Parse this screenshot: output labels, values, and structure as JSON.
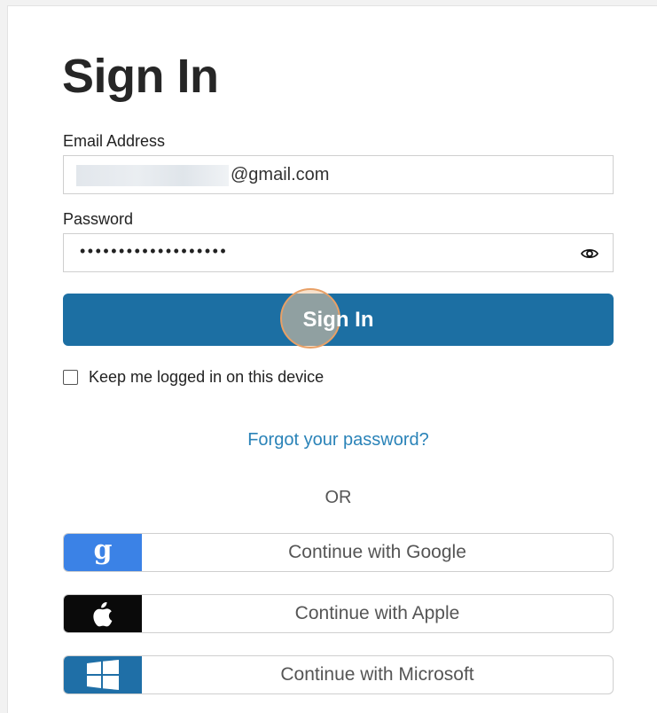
{
  "page": {
    "title": "Sign In"
  },
  "form": {
    "email_label": "Email Address",
    "email_value_visible": "@gmail.com",
    "password_label": "Password",
    "password_value_masked": "•••••••••••••••••••",
    "signin_label": "Sign In",
    "keep_logged_in_label": "Keep me logged in on this device",
    "keep_logged_in_checked": false,
    "forgot_link": "Forgot your password?",
    "or_divider": "OR"
  },
  "sso": [
    {
      "label": "Continue with Google",
      "icon": "google-g-icon",
      "color": "#3b82e6"
    },
    {
      "label": "Continue with Apple",
      "icon": "apple-icon",
      "color": "#0a0a0a"
    },
    {
      "label": "Continue with Microsoft",
      "icon": "windows-icon",
      "color": "#1f6fa7"
    }
  ],
  "colors": {
    "primary": "#1c6fa3",
    "link": "#2a83b8"
  }
}
